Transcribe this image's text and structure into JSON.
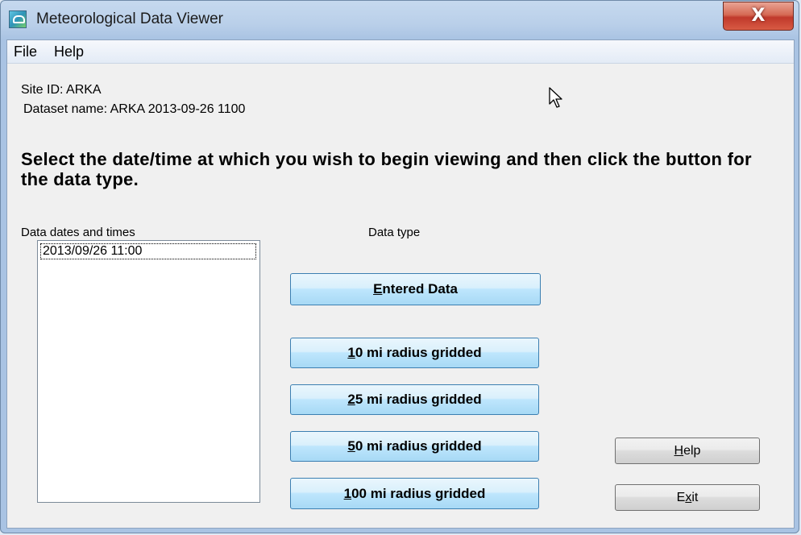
{
  "window": {
    "title": "Meteorological Data Viewer",
    "close_label": "X"
  },
  "menu": {
    "file": "File",
    "help": "Help"
  },
  "info": {
    "site_id": "Site ID:  ARKA",
    "dataset_name": "Dataset name: ARKA 2013-09-26 1100"
  },
  "instructions": "Select the date/time at which you wish to begin viewing and then click the button for the data type.",
  "list": {
    "label": "Data dates and times",
    "items": [
      "2013/09/26 11:00"
    ],
    "selected_index": 0
  },
  "data_type": {
    "label": "Data type",
    "buttons": [
      {
        "mnemonic": "E",
        "rest": "ntered Data"
      },
      {
        "mnemonic": "1",
        "rest": "0 mi radius gridded"
      },
      {
        "mnemonic": "2",
        "rest": "5 mi radius gridded"
      },
      {
        "mnemonic": "5",
        "rest": "0 mi radius gridded"
      },
      {
        "mnemonic": "1",
        "rest": "00 mi radius gridded"
      }
    ]
  },
  "actions": {
    "help": {
      "mnemonic": "H",
      "rest": "elp"
    },
    "exit": {
      "pre": "E",
      "mnemonic": "x",
      "rest": "it"
    }
  },
  "icons": {
    "app": "weather-app-icon",
    "cursor": "mouse-pointer-icon"
  }
}
